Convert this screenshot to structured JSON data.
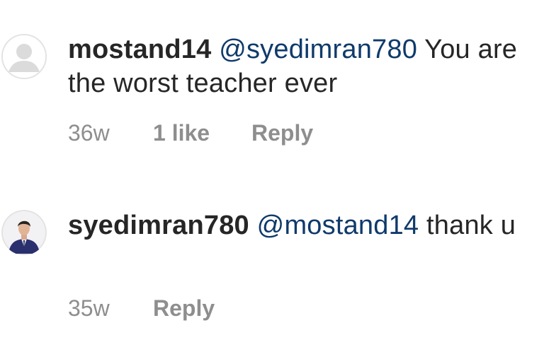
{
  "comments": [
    {
      "username": "mostand14",
      "mention": "@syedimran780",
      "text": "You are the worst teacher ever",
      "time": "36w",
      "likes": "1 like",
      "reply_label": "Reply",
      "avatar_icon": "default-avatar-icon"
    },
    {
      "username": "syedimran780",
      "mention": "@mostand14",
      "text": "thank u",
      "time": "35w",
      "reply_label": "Reply",
      "avatar_icon": "profile-photo"
    }
  ],
  "colors": {
    "text": "#262626",
    "mention": "#0f3a6b",
    "meta": "#8e8e8e"
  }
}
